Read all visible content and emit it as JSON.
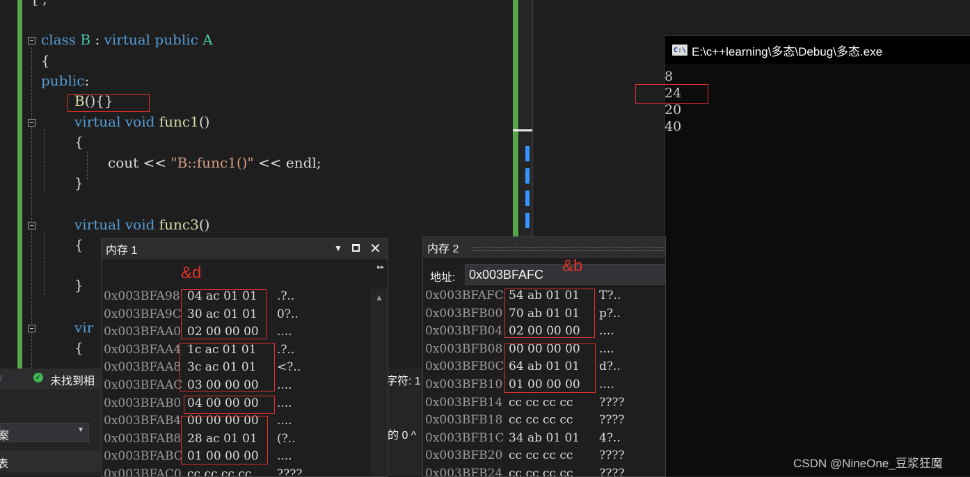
{
  "editor": {
    "lines": [
      {
        "parts": [
          {
            "t": "class ",
            "c": "kw"
          },
          {
            "t": "B",
            "c": "ty"
          },
          {
            "t": " : "
          },
          {
            "t": "virtual ",
            "c": "kw"
          },
          {
            "t": "public ",
            "c": "kw"
          },
          {
            "t": "A",
            "c": "ty"
          }
        ]
      },
      {
        "parts": [
          {
            "t": "{"
          }
        ]
      },
      {
        "parts": [
          {
            "t": "public",
            "c": "kw"
          },
          {
            "t": ":"
          }
        ]
      },
      {
        "parts": [
          {
            "t": "B",
            "c": "fn"
          },
          {
            "t": "(){}"
          }
        ]
      },
      {
        "parts": [
          {
            "t": "virtual ",
            "c": "kw"
          },
          {
            "t": "void ",
            "c": "kw"
          },
          {
            "t": "func1",
            "c": "fn"
          },
          {
            "t": "()"
          }
        ]
      },
      {
        "parts": [
          {
            "t": "{"
          }
        ]
      },
      {
        "parts": [
          {
            "t": "cout "
          },
          {
            "t": "<< "
          },
          {
            "t": "\"B::func1()\"",
            "c": "st"
          },
          {
            "t": " << "
          },
          {
            "t": "endl;"
          }
        ]
      },
      {
        "parts": [
          {
            "t": "}"
          }
        ]
      },
      {
        "parts": [
          {
            "t": "virtual ",
            "c": "kw"
          },
          {
            "t": "void ",
            "c": "kw"
          },
          {
            "t": "func3",
            "c": "fn"
          },
          {
            "t": "()"
          }
        ]
      },
      {
        "parts": [
          {
            "t": "{"
          }
        ]
      },
      {
        "parts": [
          {
            "t": "}"
          }
        ]
      },
      {
        "parts": [
          {
            "t": "vir",
            "c": "kw"
          }
        ]
      },
      {
        "parts": [
          {
            "t": "{"
          }
        ]
      }
    ]
  },
  "console": {
    "title": "E:\\c++learning\\多态\\Debug\\多态.exe",
    "icon_text": "C:\\",
    "output": [
      "8",
      "24",
      "20",
      "40"
    ]
  },
  "memory1": {
    "title": "内存 1",
    "annotation": "&d",
    "rows": [
      {
        "addr": "0x003BFA98",
        "bytes": "04 ac 01 01",
        "ascii": ".?.."
      },
      {
        "addr": "0x003BFA9C",
        "bytes": "30 ac 01 01",
        "ascii": "0?.."
      },
      {
        "addr": "0x003BFAA0",
        "bytes": "02 00 00 00",
        "ascii": "...."
      },
      {
        "addr": "0x003BFAA4",
        "bytes": "1c ac 01 01",
        "ascii": ".?.."
      },
      {
        "addr": "0x003BFAA8",
        "bytes": "3c ac 01 01",
        "ascii": "<?.."
      },
      {
        "addr": "0x003BFAAC",
        "bytes": "03 00 00 00",
        "ascii": "...."
      },
      {
        "addr": "0x003BFAB0",
        "bytes": "04 00 00 00",
        "ascii": "...."
      },
      {
        "addr": "0x003BFAB4",
        "bytes": "00 00 00 00",
        "ascii": "...."
      },
      {
        "addr": "0x003BFAB8",
        "bytes": "28 ac 01 01",
        "ascii": "(?.."
      },
      {
        "addr": "0x003BFABC",
        "bytes": "01 00 00 00",
        "ascii": "...."
      },
      {
        "addr": "0x003BFAC0",
        "bytes": "cc cc cc cc",
        "ascii": "????"
      }
    ]
  },
  "memory2": {
    "title": "内存 2",
    "annotation": "&b",
    "address_label": "地址:",
    "address_value": "0x003BFAFC",
    "rows": [
      {
        "addr": "0x003BFAFC",
        "bytes": "54 ab 01 01",
        "ascii": "T?.."
      },
      {
        "addr": "0x003BFB00",
        "bytes": "70 ab 01 01",
        "ascii": "p?.."
      },
      {
        "addr": "0x003BFB04",
        "bytes": "02 00 00 00",
        "ascii": "...."
      },
      {
        "addr": "0x003BFB08",
        "bytes": "00 00 00 00",
        "ascii": "...."
      },
      {
        "addr": "0x003BFB0C",
        "bytes": "64 ab 01 01",
        "ascii": "d?.."
      },
      {
        "addr": "0x003BFB10",
        "bytes": "01 00 00 00",
        "ascii": "...."
      },
      {
        "addr": "0x003BFB14",
        "bytes": "cc cc cc cc",
        "ascii": "????"
      },
      {
        "addr": "0x003BFB18",
        "bytes": "cc cc cc cc",
        "ascii": "????"
      },
      {
        "addr": "0x003BFB1C",
        "bytes": "34 ab 01 01",
        "ascii": "4?.."
      },
      {
        "addr": "0x003BFB20",
        "bytes": "cc cc cc cc",
        "ascii": "????"
      },
      {
        "addr": "0x003BFB24",
        "bytes": "cc cc cc cc",
        "ascii": "????"
      }
    ]
  },
  "status": {
    "search_result": "未找到相",
    "char_label": "字符: 1",
    "combo_value": "案",
    "list_label": "表",
    "count_text": "的 0 ^"
  },
  "watermark": "CSDN @NineOne_豆浆狂魔",
  "colors": {
    "accent_green": "#57a64a",
    "marker_red": "#e0322c",
    "scroll_blue": "#3794ff"
  }
}
